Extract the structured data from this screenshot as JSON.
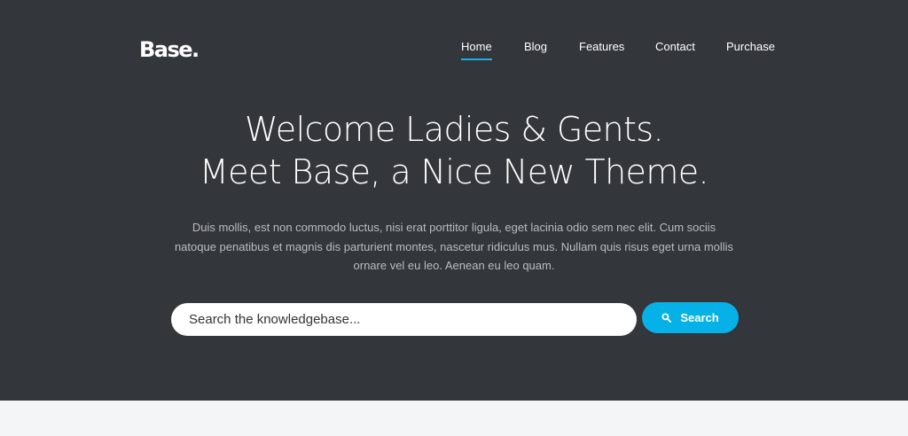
{
  "brand": {
    "logo": "Base."
  },
  "nav": {
    "items": [
      {
        "label": "Home",
        "active": true
      },
      {
        "label": "Blog",
        "active": false
      },
      {
        "label": "Features",
        "active": false
      },
      {
        "label": "Contact",
        "active": false
      },
      {
        "label": "Purchase",
        "active": false
      }
    ]
  },
  "hero": {
    "headline_line1": "Welcome Ladies & Gents.",
    "headline_line2": "Meet Base, a Nice New Theme.",
    "lead": "Duis mollis, est non commodo luctus, nisi erat porttitor ligula, eget lacinia odio sem nec elit. Cum sociis natoque penatibus et magnis dis parturient montes, nascetur ridiculus mus. Nullam quis risus eget urna mollis ornare vel eu leo. Aenean eu leo quam."
  },
  "search": {
    "placeholder": "Search the knowledgebase...",
    "button_label": "Search",
    "button_icon": "search-icon"
  },
  "colors": {
    "hero_background": "#33363b",
    "accent": "#06b1e8",
    "page_background": "#f3f5f6"
  }
}
